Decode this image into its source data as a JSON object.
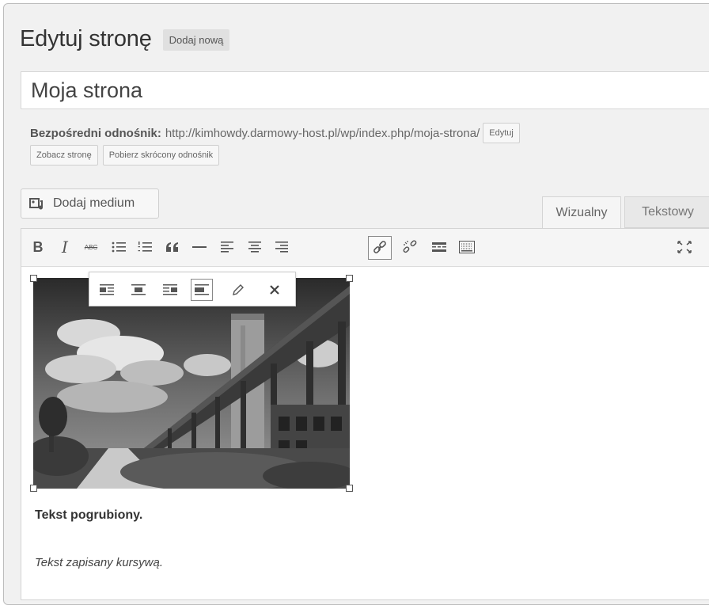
{
  "header": {
    "title": "Edytuj stronę",
    "add_new_label": "Dodaj nową"
  },
  "post": {
    "title": "Moja strona"
  },
  "permalink": {
    "label": "Bezpośredni odnośnik:",
    "url": "http://kimhowdy.darmowy-host.pl/wp/index.php/moja-strona/",
    "edit_label": "Edytuj",
    "view_label": "Zobacz stronę",
    "shortlink_label": "Pobierz skrócony odnośnik"
  },
  "media": {
    "add_media_label": "Dodaj medium"
  },
  "tabs": [
    {
      "label": "Wizualny",
      "active": true
    },
    {
      "label": "Tekstowy",
      "active": false
    }
  ],
  "toolbar": {
    "bold": "B",
    "italic": "I",
    "strikethrough": "ABC",
    "buttons": [
      "bold-icon",
      "italic-icon",
      "strikethrough-icon",
      "bulleted-list-icon",
      "numbered-list-icon",
      "blockquote-icon",
      "horizontal-rule-icon",
      "align-left-icon",
      "align-center-icon",
      "align-right-icon",
      "insert-link-icon",
      "unlink-icon",
      "read-more-icon",
      "toolbar-toggle-icon",
      "fullscreen-icon"
    ],
    "active_button": "insert-link-icon"
  },
  "image_toolbar": {
    "buttons": [
      "align-left-icon",
      "align-center-icon",
      "align-right-icon",
      "align-none-icon",
      "edit-icon",
      "remove-icon"
    ],
    "active_button": "align-none-icon"
  },
  "content": {
    "bold_text": "Tekst pogrubiony.",
    "italic_text": "Tekst zapisany kursywą."
  }
}
